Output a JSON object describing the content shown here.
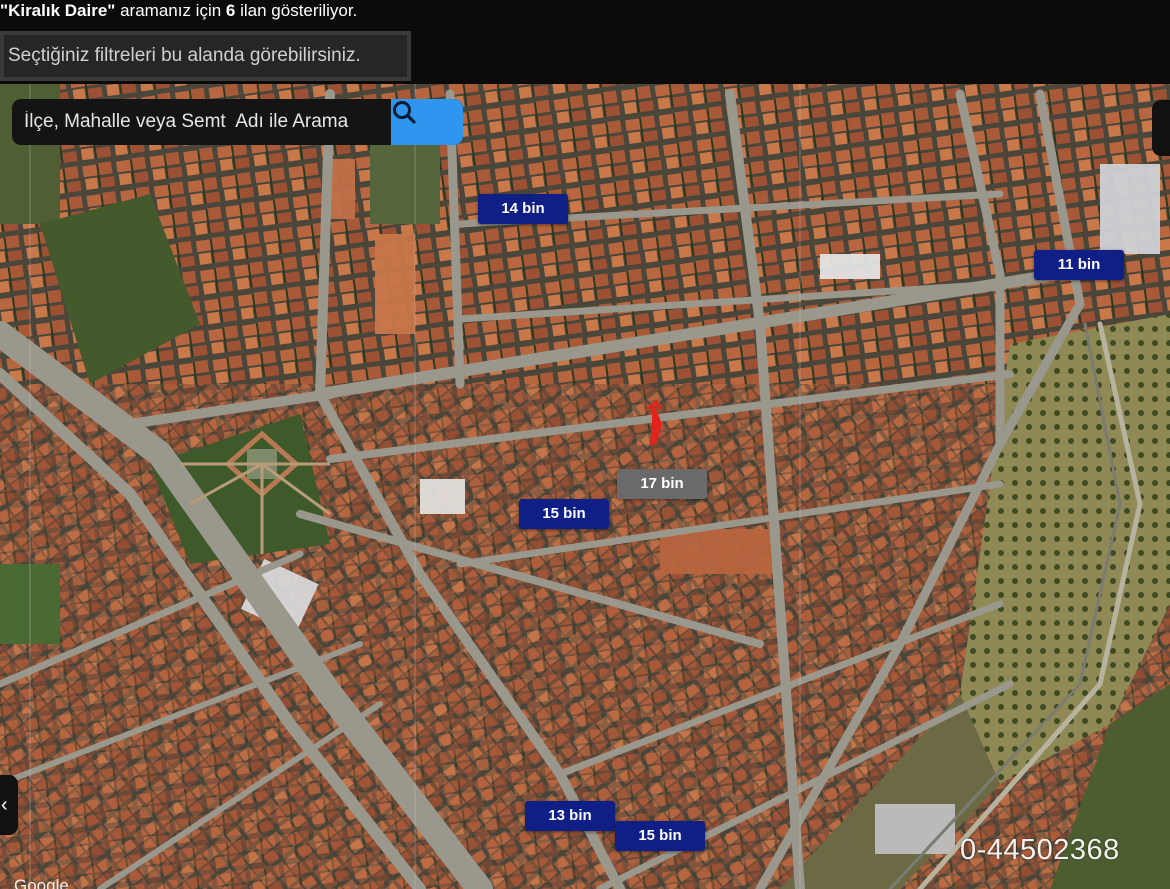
{
  "header": {
    "query_open": "\"",
    "query": "Kiralık Daire",
    "query_close": "\"",
    "text_before_count": " aramanız için ",
    "result_count": "6",
    "text_after_count": " ilan gösteriliyor.",
    "filter_placeholder": "Seçtiğiniz filtreleri bu alanda görebilirsiniz."
  },
  "map": {
    "search_placeholder": "İlçe, Mahalle veya Semt  Adı ile Arama",
    "search_icon": "search-icon",
    "left_toggle_label": "‹",
    "markers": [
      {
        "label": "14 bin",
        "visited": false
      },
      {
        "label": "11 bin",
        "visited": false
      },
      {
        "label": "17 bin",
        "visited": true
      },
      {
        "label": "15 bin",
        "visited": false
      },
      {
        "label": "13 bin",
        "visited": false
      },
      {
        "label": "15 bin",
        "visited": false
      }
    ],
    "phone_watermark": "0-44502368",
    "provider_logo": "Google"
  },
  "colors": {
    "marker": "#101f86",
    "marker_visited": "#6a6a6a",
    "search_button": "#2e96ee",
    "roof": "#b8663f",
    "road": "#9a978c",
    "park": "#3f5a2a"
  }
}
